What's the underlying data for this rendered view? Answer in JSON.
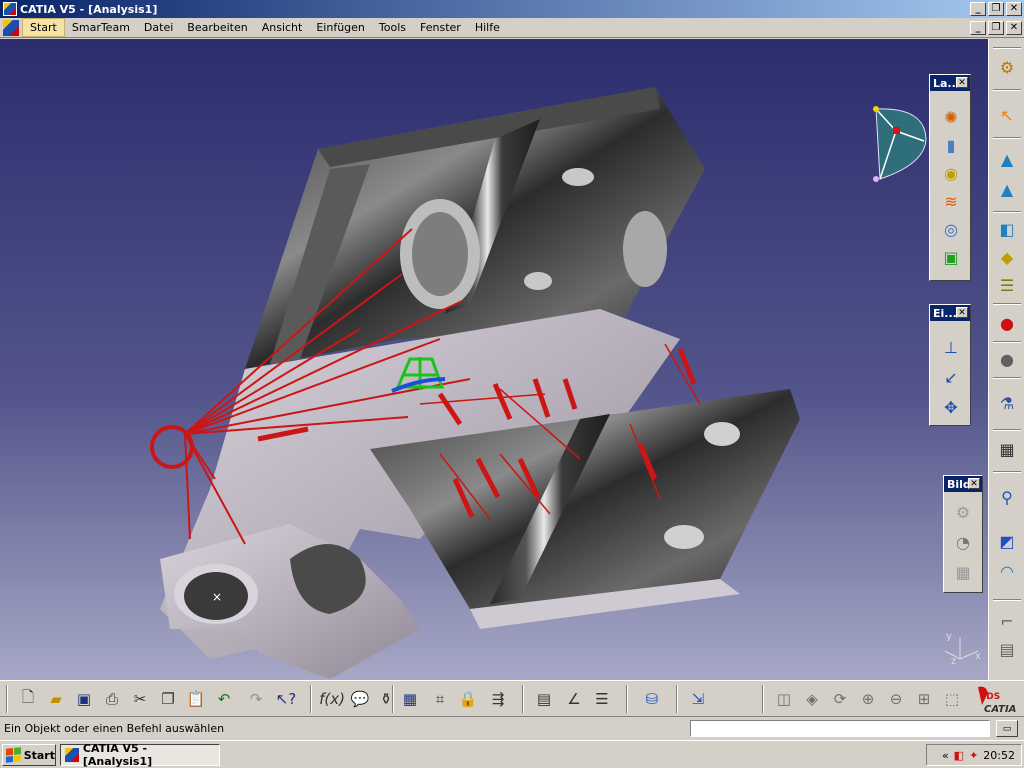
{
  "window": {
    "title": "CATIA V5 - [Analysis1]",
    "minimize": "_",
    "restore": "❐",
    "close": "✕"
  },
  "menu": {
    "items": [
      "Start",
      "SmarTeam",
      "Datei",
      "Bearbeiten",
      "Ansicht",
      "Einfügen",
      "Tools",
      "Fenster",
      "Hilfe"
    ]
  },
  "floating_toolbars": {
    "la": {
      "title": "La..."
    },
    "ei": {
      "title": "Ei..."
    },
    "bild": {
      "title": "Bild"
    }
  },
  "compass": {
    "axis_x": "x",
    "axis_y": "y",
    "axis_z": "z"
  },
  "brand": {
    "logo_text": "CATIA",
    "logo_mark": "3DS"
  },
  "status": {
    "message": "Ein Objekt oder einen Befehl auswählen",
    "command_value": ""
  },
  "taskbar": {
    "start_label": "Start",
    "task_label": "CATIA V5 - [Analysis1]",
    "clock": "20:52",
    "tray_chevron": "«"
  },
  "icons": {
    "new": "new-document-icon",
    "open": "open-folder-icon",
    "save": "save-icon",
    "print": "print-icon",
    "cut": "cut-icon",
    "copy": "copy-icon",
    "paste": "paste-icon",
    "undo": "undo-icon",
    "redo": "redo-icon",
    "help": "whats-this-icon",
    "formula": "formula-icon",
    "knowledge": "knowledge-icon"
  },
  "colors": {
    "titlebar_start": "#0a246a",
    "viewport_top": "#2c2d6e",
    "viewport_bottom": "#a7a8c6",
    "restraint_red": "#cc1515",
    "load_green": "#19c419"
  }
}
